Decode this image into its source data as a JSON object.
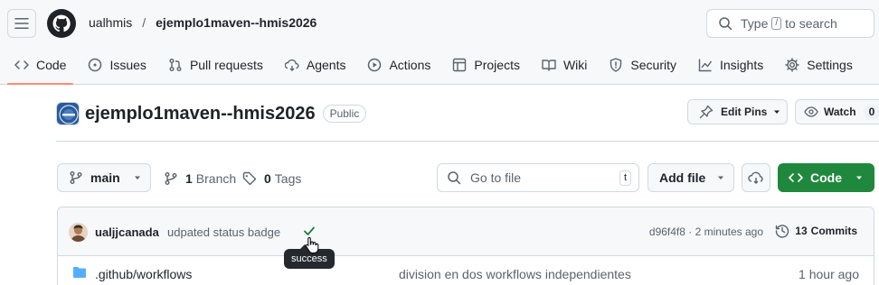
{
  "header": {
    "owner": "ualhmis",
    "separator": "/",
    "repo": "ejemplo1maven--hmis2026",
    "search_before": "Type",
    "search_key": "/",
    "search_after": "to search"
  },
  "tabs": [
    {
      "label": "Code",
      "icon": "code-icon",
      "active": true
    },
    {
      "label": "Issues",
      "icon": "issue-opened-icon"
    },
    {
      "label": "Pull requests",
      "icon": "git-pull-request-icon"
    },
    {
      "label": "Agents",
      "icon": "agent-icon"
    },
    {
      "label": "Actions",
      "icon": "play-icon"
    },
    {
      "label": "Projects",
      "icon": "table-icon"
    },
    {
      "label": "Wiki",
      "icon": "book-icon"
    },
    {
      "label": "Security",
      "icon": "shield-icon"
    },
    {
      "label": "Insights",
      "icon": "graph-icon"
    },
    {
      "label": "Settings",
      "icon": "gear-icon"
    }
  ],
  "repo": {
    "name": "ejemplo1maven--hmis2026",
    "visibility": "Public",
    "edit_pins": "Edit Pins",
    "watch": "Watch",
    "watch_count": "0"
  },
  "toolbar": {
    "branch": "main",
    "branch_count": "1",
    "branch_label": "Branch",
    "tag_count": "0",
    "tag_label": "Tags",
    "goto_placeholder": "Go to file",
    "goto_key": "t",
    "add_file": "Add file",
    "code": "Code"
  },
  "commit": {
    "author": "ualjjcanada",
    "message": "udpated status badge",
    "tooltip": "success",
    "sha_time": "d96f4f8 · 2 minutes ago",
    "commits_count": "13",
    "commits_label": "Commits"
  },
  "files": [
    {
      "name": ".github/workflows",
      "message": "division en dos workflows independientes",
      "time": "1 hour ago"
    }
  ],
  "colors": {
    "accent_underline": "#fd8c73",
    "code_button": "#1f883d",
    "folder": "#54aeff",
    "success": "#1a7f37"
  }
}
